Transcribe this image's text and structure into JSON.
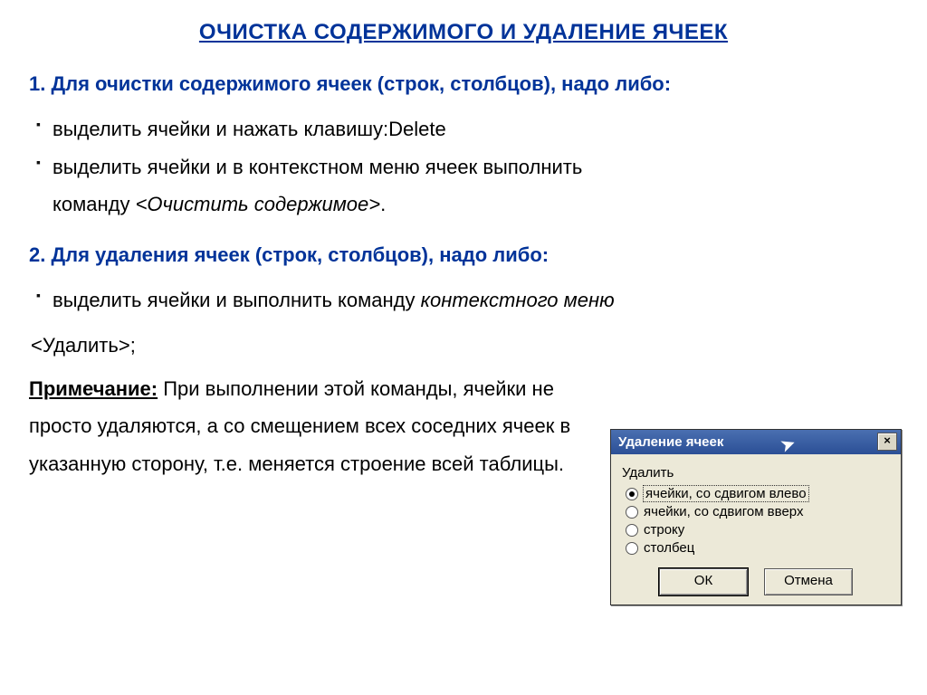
{
  "title": "ОЧИСТКА СОДЕРЖИМОГО И УДАЛЕНИЕ ЯЧЕЕК",
  "section1": {
    "heading": "1. Для очистки содержимого ячеек (строк, столбцов), надо либо:",
    "bullet1": "выделить ячейки и нажать клавишу:Delete",
    "bullet2a": "выделить ячейки и в контекстном меню ячеек выполнить",
    "bullet2b_prefix": "команду ",
    "bullet2b_cmd": "<Очистить содержимое>",
    "bullet2b_suffix": "."
  },
  "section2": {
    "heading": "2.  Для удаления ячеек (строк, столбцов), надо либо:",
    "bullet1a": "выделить ячейки и выполнить команду ",
    "bullet1a_italic": "контекстного меню",
    "bullet1b": "<Удалить>;"
  },
  "note": {
    "label": "Примечание:",
    "text": " При выполнении этой команды, ячейки не просто удаляются, а со смещением всех соседних ячеек в указанную сторону, т.е. меняется строение всей таблицы."
  },
  "dialog": {
    "title": "Удаление ячеек",
    "close": "×",
    "group_label": "Удалить",
    "options": [
      {
        "label": "ячейки, со сдвигом влево",
        "checked": true,
        "focused": true
      },
      {
        "label": "ячейки, со сдвигом вверх",
        "checked": false,
        "focused": false
      },
      {
        "label": "строку",
        "checked": false,
        "focused": false
      },
      {
        "label": "столбец",
        "checked": false,
        "focused": false
      }
    ],
    "ok": "ОК",
    "cancel": "Отмена"
  }
}
